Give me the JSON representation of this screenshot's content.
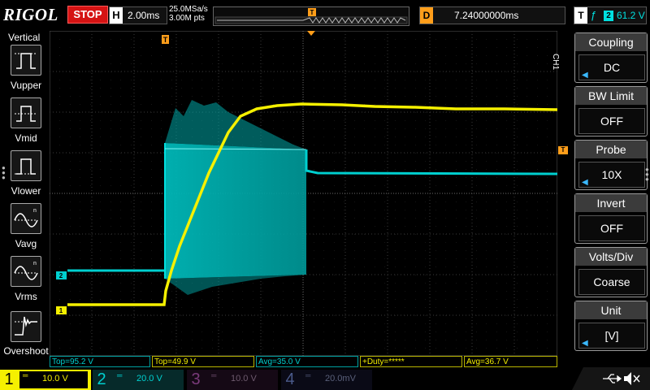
{
  "brand": "RIGOL",
  "run_state": "STOP",
  "horizontal": {
    "key": "H",
    "timebase": "2.00ms"
  },
  "acquisition": {
    "sample_rate": "25.0MSa/s",
    "memory_depth": "3.00M pts"
  },
  "delay": {
    "key": "D",
    "value": "7.24000000ms"
  },
  "trigger": {
    "key": "T",
    "edge": "ƒ",
    "source": "2",
    "level": "61.2 V"
  },
  "vertical_menu": {
    "title": "Vertical",
    "items": [
      {
        "label": "Vupper",
        "icon": "vupper-icon"
      },
      {
        "label": "Vmid",
        "icon": "vmid-icon"
      },
      {
        "label": "Vlower",
        "icon": "vlower-icon"
      },
      {
        "label": "Vavg",
        "icon": "vavg-icon"
      },
      {
        "label": "Vrms",
        "icon": "vrms-icon"
      },
      {
        "label": "Overshoot",
        "icon": "overshoot-icon"
      }
    ]
  },
  "channel_menu": {
    "channel_tag": "CH1",
    "items": [
      {
        "title": "Coupling",
        "value": "DC",
        "has_arrow": true
      },
      {
        "title": "BW Limit",
        "value": "OFF",
        "has_arrow": false
      },
      {
        "title": "Probe",
        "value": "10X",
        "has_arrow": true
      },
      {
        "title": "Invert",
        "value": "OFF",
        "has_arrow": false
      },
      {
        "title": "Volts/Div",
        "value": "Coarse",
        "has_arrow": false
      },
      {
        "title": "Unit",
        "value": "[V]",
        "has_arrow": true
      }
    ]
  },
  "markers": {
    "trigger_pos": "T",
    "ch1": "1",
    "ch2": "2",
    "trig_level": "T"
  },
  "measurements": [
    {
      "text": "Top=95.2 V",
      "color": "#00d0d0"
    },
    {
      "text": "Top=49.9 V",
      "color": "#f5f000"
    },
    {
      "text": "Avg=35.0 V",
      "color": "#00d0d0"
    },
    {
      "text": "+Duty=*****",
      "color": "#f5f000"
    },
    {
      "text": "Avg=36.7 V",
      "color": "#f5f000"
    }
  ],
  "channels": [
    {
      "num": "1",
      "scale": "10.0 V",
      "color": "#f5f000",
      "active": true
    },
    {
      "num": "2",
      "scale": "20.0 V",
      "color": "#00d0d0",
      "active": false
    },
    {
      "num": "3",
      "scale": "10.0 V",
      "color": "#d050d0",
      "active": false
    },
    {
      "num": "4",
      "scale": "20.0mV",
      "color": "#3080ff",
      "active": false
    }
  ],
  "colors": {
    "ch1": "#f5f000",
    "ch2": "#00d0d0",
    "accent": "#ff9e1a",
    "stop": "#d51313"
  }
}
